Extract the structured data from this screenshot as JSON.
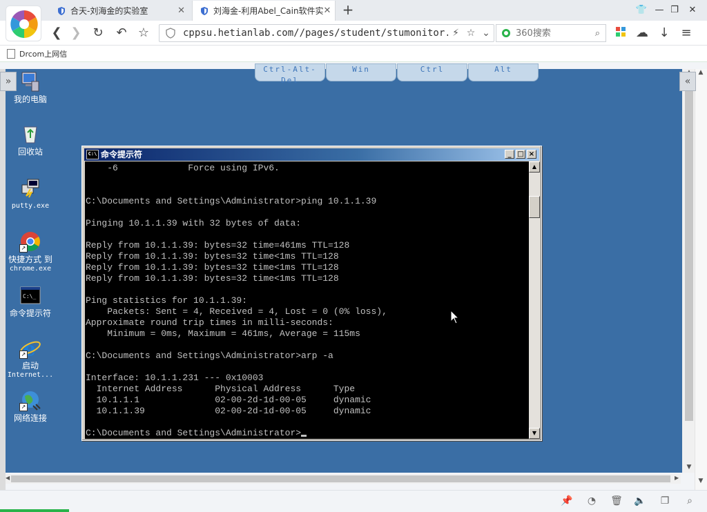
{
  "browser": {
    "tabs": [
      {
        "title": "合天-刘海金的实验室",
        "close": "✕"
      },
      {
        "title": "刘海金-利用Abel_Cain软件实",
        "close": "✕"
      }
    ],
    "new_tab": "+",
    "address": "cppsu.hetianlab.com//pages/student/stumonitor.js",
    "search_placeholder": "360搜索",
    "bookmark": "Drcom上网信",
    "accent_color": "#29b34a"
  },
  "remote": {
    "keys": [
      "Ctrl-Alt-Del",
      "Win",
      "Ctrl",
      "Alt"
    ],
    "side_tab_left": "»",
    "side_tab_right": "«",
    "desktop_icons": [
      {
        "label": "我的电脑"
      },
      {
        "label": "回收站"
      },
      {
        "label": "putty.exe"
      },
      {
        "label": "快捷方式 到",
        "sub": "chrome.exe"
      },
      {
        "label": "命令提示符"
      },
      {
        "label": "启动",
        "sub": "Internet..."
      },
      {
        "label": "网络连接"
      }
    ],
    "desktop_color": "#3a6ea5"
  },
  "cmd": {
    "title": "命令提示符",
    "lines": [
      "    -6             Force using IPv6.",
      "",
      "",
      "C:\\Documents and Settings\\Administrator>ping 10.1.1.39",
      "",
      "Pinging 10.1.1.39 with 32 bytes of data:",
      "",
      "Reply from 10.1.1.39: bytes=32 time=461ms TTL=128",
      "Reply from 10.1.1.39: bytes=32 time<1ms TTL=128",
      "Reply from 10.1.1.39: bytes=32 time<1ms TTL=128",
      "Reply from 10.1.1.39: bytes=32 time<1ms TTL=128",
      "",
      "Ping statistics for 10.1.1.39:",
      "    Packets: Sent = 4, Received = 4, Lost = 0 (0% loss),",
      "Approximate round trip times in milli-seconds:",
      "    Minimum = 0ms, Maximum = 461ms, Average = 115ms",
      "",
      "C:\\Documents and Settings\\Administrator>arp -a",
      "",
      "Interface: 10.1.1.231 --- 0x10003",
      "  Internet Address      Physical Address      Type",
      "  10.1.1.1              02-00-2d-1d-00-05     dynamic",
      "  10.1.1.39             02-00-2d-1d-00-05     dynamic",
      "",
      "C:\\Documents and Settings\\Administrator>"
    ]
  }
}
